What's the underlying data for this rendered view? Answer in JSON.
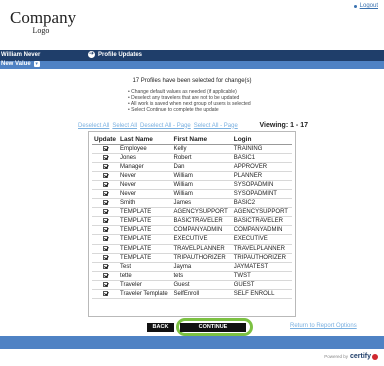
{
  "header": {
    "logout_label": "Logout",
    "logo_main": "Company",
    "logo_sub": "Logo"
  },
  "nav": {
    "user_name": "William Never",
    "profile_updates_label": "Profile Updates",
    "new_value_label": "New Value"
  },
  "summary": {
    "title": "17 Profiles have been selected for change(s)",
    "instructions": [
      "Change default values as needed (if applicable)",
      "Deselect any travelers that are not to be updated",
      "All work is saved when next group of users is selected",
      "Select Continue to complete the update"
    ]
  },
  "toolbar": {
    "deselect_all": "Deselect All",
    "select_all": "Select All",
    "deselect_all_page": "Deselect All - Page",
    "select_all_page": "Select All - Page",
    "viewing": "Viewing: 1 - 17"
  },
  "table": {
    "headers": [
      "Update",
      "Last Name",
      "First Name",
      "Login"
    ],
    "rows": [
      {
        "last": "Employee",
        "first": "Kelly",
        "login": "TRAINING"
      },
      {
        "last": "Jones",
        "first": "Robert",
        "login": "BASIC1"
      },
      {
        "last": "Manager",
        "first": "Dan",
        "login": "APPROVER"
      },
      {
        "last": "Never",
        "first": "William",
        "login": "PLANNER"
      },
      {
        "last": "Never",
        "first": "William",
        "login": "SYSOPADMIN"
      },
      {
        "last": "Never",
        "first": "William",
        "login": "SYSOPADMINT"
      },
      {
        "last": "Smith",
        "first": "James",
        "login": "BASIC2"
      },
      {
        "last": "TEMPLATE",
        "first": "AGENCYSUPPORT",
        "login": "AGENCYSUPPORT"
      },
      {
        "last": "TEMPLATE",
        "first": "BASICTRAVELER",
        "login": "BASICTRAVELER"
      },
      {
        "last": "TEMPLATE",
        "first": "COMPANYADMIN",
        "login": "COMPANYADMIN"
      },
      {
        "last": "TEMPLATE",
        "first": "EXECUTIVE",
        "login": "EXECUTIVE"
      },
      {
        "last": "TEMPLATE",
        "first": "TRAVELPLANNER",
        "login": "TRAVELPLANNER"
      },
      {
        "last": "TEMPLATE",
        "first": "TRIPAUTHORIZER",
        "login": "TRIPAUTHORIZER"
      },
      {
        "last": "Test",
        "first": "Jayma",
        "login": "JAYMATEST"
      },
      {
        "last": "tette",
        "first": "tets",
        "login": "TWST"
      },
      {
        "last": "Traveler",
        "first": "Guest",
        "login": "GUEST"
      },
      {
        "last": "Traveler Template",
        "first": "SelfEnroll",
        "login": "SELF ENROLL"
      }
    ]
  },
  "actions": {
    "back_label": "BACK",
    "continue_label": "CONTINUE",
    "return_label": "Return to Report Options"
  },
  "footer": {
    "powered_by": "Powered by",
    "brand": "certify"
  },
  "colors": {
    "band_dark": "#1f3e6a",
    "band_light": "#4f82c4",
    "link": "#7ab0e0",
    "continue_ring": "#7cc142"
  }
}
